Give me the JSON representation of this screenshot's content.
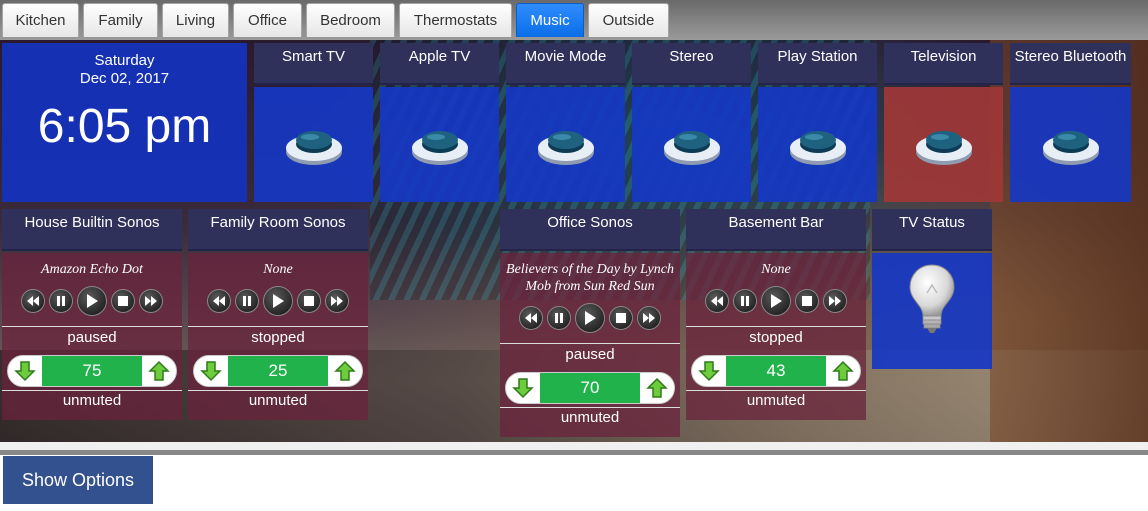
{
  "tabs": [
    {
      "label": "Kitchen",
      "active": false
    },
    {
      "label": "Family",
      "active": false
    },
    {
      "label": "Living",
      "active": false
    },
    {
      "label": "Office",
      "active": false
    },
    {
      "label": "Bedroom",
      "active": false
    },
    {
      "label": "Thermostats",
      "active": false
    },
    {
      "label": "Music",
      "active": true
    },
    {
      "label": "Outside",
      "active": false
    }
  ],
  "clock": {
    "day": "Saturday",
    "date": "Dec 02, 2017",
    "time": "6:05 pm"
  },
  "buttons": [
    {
      "label": "Smart TV",
      "state": "off"
    },
    {
      "label": "Apple TV",
      "state": "off"
    },
    {
      "label": "Movie Mode",
      "state": "off"
    },
    {
      "label": "Stereo",
      "state": "off"
    },
    {
      "label": "Play Station",
      "state": "off"
    },
    {
      "label": "Television",
      "state": "on"
    },
    {
      "label": "Stereo Bluetooth",
      "state": "off"
    }
  ],
  "sonos": [
    {
      "title": "House Builtin Sonos",
      "track": "Amazon Echo Dot",
      "status": "paused",
      "volume": "75",
      "mute": "unmuted"
    },
    {
      "title": "Family Room Sonos",
      "track": "None",
      "status": "stopped",
      "volume": "25",
      "mute": "unmuted"
    },
    {
      "title": "Office Sonos",
      "track": "Believers of the Day by Lynch Mob from Sun Red Sun",
      "status": "paused",
      "volume": "70",
      "mute": "unmuted"
    },
    {
      "title": "Basement Bar",
      "track": "None",
      "status": "stopped",
      "volume": "43",
      "mute": "unmuted"
    }
  ],
  "tv_status": {
    "title": "TV Status",
    "icon": "lightbulb-icon",
    "state": "off"
  },
  "show_options_label": "Show Options",
  "colors": {
    "tab_active": "#1273eb",
    "tile_blue": "#1637c3",
    "tile_red": "#a03737",
    "volume_green": "#22b24c",
    "header": "#30315a"
  }
}
